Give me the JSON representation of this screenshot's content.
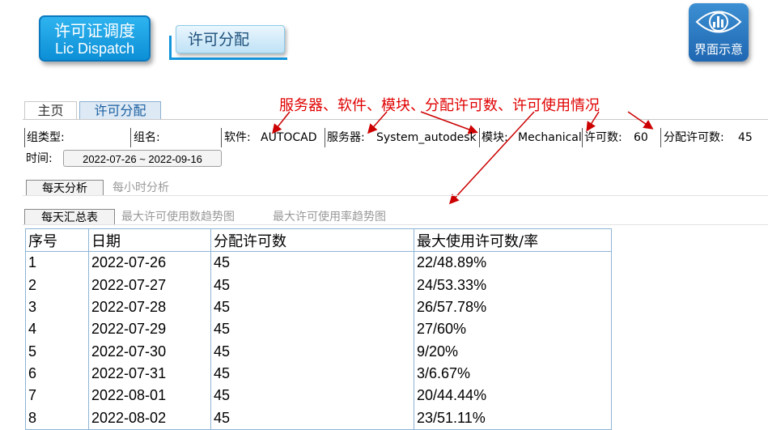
{
  "header": {
    "main_badge_line1": "许可证调度",
    "main_badge_line2": "Lic Dispatch",
    "sub_badge": "许可分配",
    "right_badge": "界面示意",
    "right_icon": "eye-chart-icon"
  },
  "tabs": [
    {
      "label": "主页"
    },
    {
      "label": "许可分配"
    }
  ],
  "annotation": "服务器、软件、模块、分配许可数、许可使用情况",
  "filters": {
    "group_type_label": "组类型:",
    "group_name_label": "组名:",
    "software_label": "软件:",
    "software_value": "AUTOCAD",
    "server_label": "服务器:",
    "server_value": "System_autodesk",
    "module_label": "模块:",
    "module_value": "Mechanical",
    "license_count_label": "许可数:",
    "license_count_value": "60",
    "allocated_label": "分配许可数:",
    "allocated_value": "45",
    "time_label": "时间:",
    "time_range": "2022-07-26 ~ 2022-09-16"
  },
  "analysis_tabs": [
    {
      "label": "每天分析"
    },
    {
      "label": "每小时分析"
    }
  ],
  "view_tabs": [
    {
      "label": "每天汇总表"
    },
    {
      "label": "最大许可使用数趋势图"
    },
    {
      "label": "最大许可使用率趋势图"
    }
  ],
  "table": {
    "columns": [
      "序号",
      "日期",
      "分配许可数",
      "最大使用许可数/率"
    ],
    "rows": [
      [
        "1",
        "2022-07-26",
        "45",
        "22/48.89%"
      ],
      [
        "2",
        "2022-07-27",
        "45",
        "24/53.33%"
      ],
      [
        "3",
        "2022-07-28",
        "45",
        "26/57.78%"
      ],
      [
        "4",
        "2022-07-29",
        "45",
        "27/60%"
      ],
      [
        "5",
        "2022-07-30",
        "45",
        "9/20%"
      ],
      [
        "6",
        "2022-07-31",
        "45",
        "3/6.67%"
      ],
      [
        "7",
        "2022-08-01",
        "45",
        "20/44.44%"
      ],
      [
        "8",
        "2022-08-02",
        "45",
        "23/51.11%"
      ]
    ]
  },
  "colors": {
    "accent_blue": "#1496dc",
    "annotation_red": "#e00000",
    "table_border": "#8eb4d6"
  }
}
